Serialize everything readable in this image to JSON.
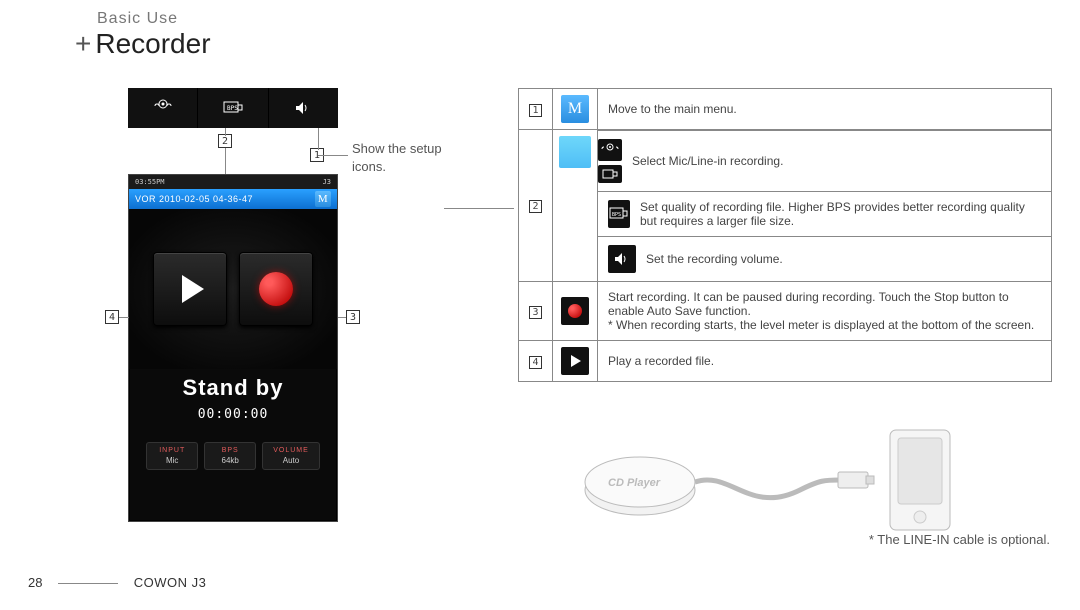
{
  "header": {
    "section_label": "Basic Use",
    "page_title": "Recorder",
    "plus": "+"
  },
  "footer": {
    "page_number": "28",
    "model": "COWON J3"
  },
  "callout_labels": {
    "one": "1",
    "two": "2",
    "three": "3",
    "four": "4"
  },
  "callout_text": {
    "setup_line1": "Show the setup",
    "setup_line2": "icons."
  },
  "device": {
    "status_left": "03:55PM",
    "status_right": "J3",
    "vor_line": "VOR 2010-02-05 04-36-47",
    "standby": "Stand by",
    "timer": "00:00:00",
    "pills": [
      {
        "label": "INPUT",
        "value": "Mic"
      },
      {
        "label": "BPS",
        "value": "64kb"
      },
      {
        "label": "VOLUME",
        "value": "Auto"
      }
    ]
  },
  "icons": {
    "m_letter": "M",
    "mic_select": "mic-line-icon",
    "bps": "bps-icon",
    "volume": "volume-icon",
    "play": "play-icon",
    "record": "record-icon"
  },
  "table": {
    "row1": {
      "num": "1",
      "desc": "Move to the main menu."
    },
    "row2a": {
      "desc": "Select Mic/Line-in recording."
    },
    "row2b": {
      "desc": "Set quality of recording file. Higher BPS provides better recording quality but requires a larger file size."
    },
    "row2c": {
      "desc": "Set the recording volume."
    },
    "row2_num": "2",
    "row3": {
      "num": "3",
      "desc": "Start recording. It can be paused during recording. Touch the Stop button to enable Auto Save function.\n* When recording starts, the level meter is displayed at the bottom of the screen."
    },
    "row4": {
      "num": "4",
      "desc": "Play a recorded file."
    }
  },
  "note": "* The LINE-IN cable is optional.",
  "illustration_label": "CD Player"
}
